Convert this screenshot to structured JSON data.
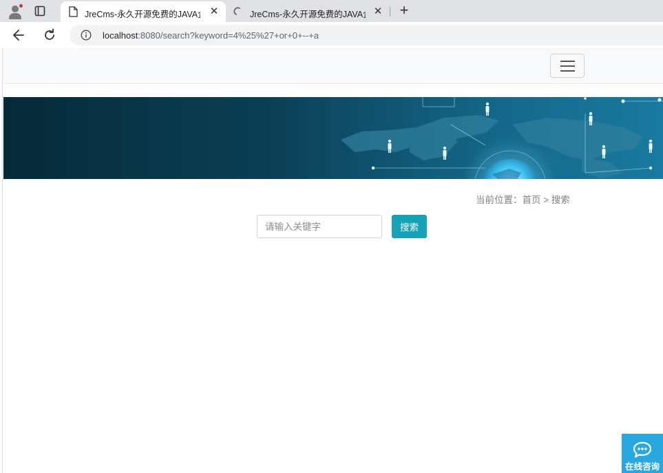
{
  "browser": {
    "tabs": [
      {
        "title": "JreCms-永久开源免费的JAVA企业",
        "active": true,
        "favicon": "page-icon"
      },
      {
        "title": "JreCms-永久开源免费的JAVA企业",
        "active": false,
        "favicon": "loading-icon"
      }
    ],
    "close_glyph": "✕",
    "new_tab_glyph": "+",
    "url_host": "localhost",
    "url_rest": ":8080/search?keyword=4%25%27+or+0+--+a"
  },
  "page": {
    "breadcrumb": {
      "prefix": "当前位置：",
      "home": "首页",
      "separator": " > ",
      "current": "搜索"
    },
    "search": {
      "placeholder": "请输入关键字",
      "value": "",
      "button_label": "搜索"
    },
    "consult_button": {
      "label": "在线咨询"
    }
  },
  "colors": {
    "accent": "#17a2b8",
    "consult": "#29a8e0",
    "banner_dark": "#062a38",
    "banner_light": "#1a7aa0"
  }
}
